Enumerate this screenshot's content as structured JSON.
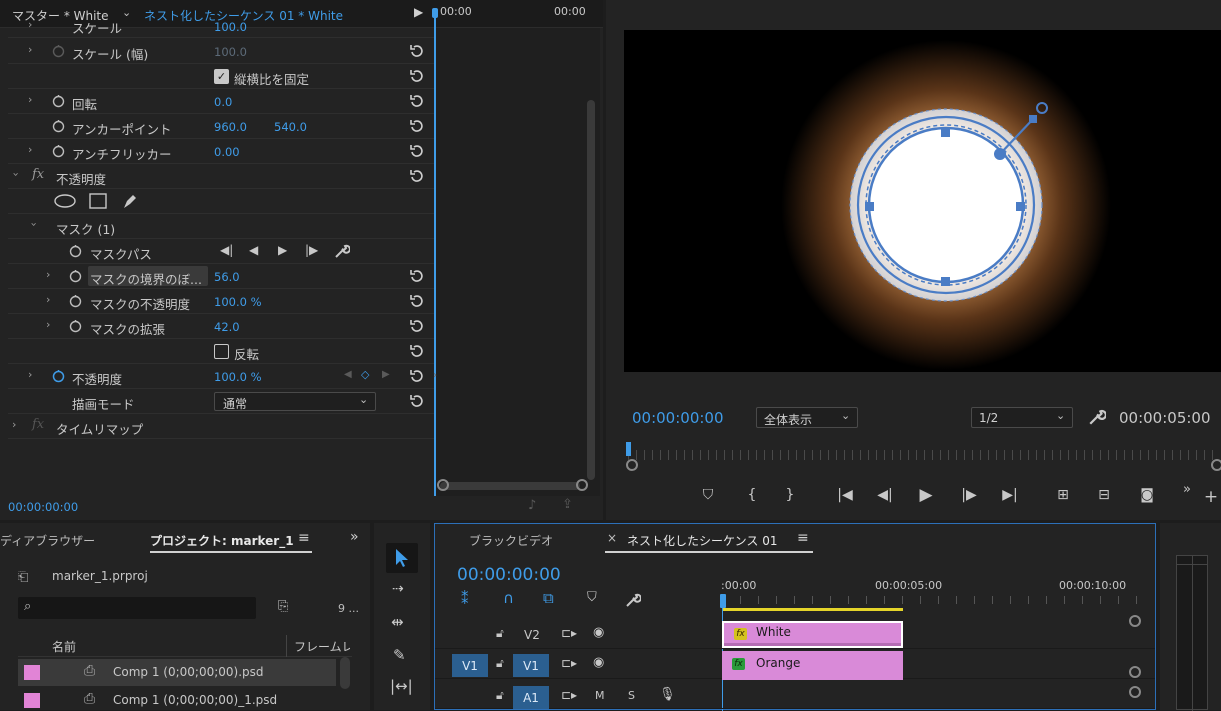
{
  "effect_controls": {
    "tab_master": "マスター * White",
    "tab_sequence": "ネスト化したシーケンス 01 * White",
    "tl_time_start": "00:00",
    "tl_time_end": "00:00",
    "footer_time": "00:00:00:00",
    "rows": {
      "scale": {
        "label": "スケール",
        "value": "100.0"
      },
      "scale_width": {
        "label": "スケール (幅)",
        "value": "100.0"
      },
      "uniform": {
        "label": "縦横比を固定"
      },
      "rotation": {
        "label": "回転",
        "value": "0.0"
      },
      "anchor": {
        "label": "アンカーポイント",
        "x": "960.0",
        "y": "540.0"
      },
      "antiflicker": {
        "label": "アンチフリッカー",
        "value": "0.00"
      },
      "opacity_group": {
        "label": "不透明度"
      },
      "mask": {
        "label": "マスク (1)"
      },
      "mask_path": {
        "label": "マスクパス"
      },
      "mask_feather": {
        "label": "マスクの境界のぼ...",
        "value": "56.0"
      },
      "mask_opacity": {
        "label": "マスクの不透明度",
        "value": "100.0 %"
      },
      "mask_expansion": {
        "label": "マスクの拡張",
        "value": "42.0"
      },
      "inverted": {
        "label": "反転"
      },
      "opacity": {
        "label": "不透明度",
        "value": "100.0 %"
      },
      "blend_mode": {
        "label": "描画モード",
        "value": "通常"
      },
      "time_remap": {
        "label": "タイムリマップ"
      }
    }
  },
  "program_monitor": {
    "timecode": "00:00:00:00",
    "fit": "全体表示",
    "resolution": "1/2",
    "duration": "00:00:05:00"
  },
  "project": {
    "tab_media": "ディアブラウザー",
    "tab_project": "プロジェクト: marker_1",
    "file_name": "marker_1.prproj",
    "item_count": "9 ...",
    "col_name": "名前",
    "col_framerate": "フレームレ",
    "items": [
      {
        "name": "Comp 1 (0;00;00;00).psd"
      },
      {
        "name": "Comp 1 (0;00;00;00)_1.psd"
      }
    ],
    "label_color": "#e184d6"
  },
  "timeline": {
    "tab_black": "ブラックビデオ",
    "tab_nested": "ネスト化したシーケンス 01",
    "timecode": "00:00:00:00",
    "ruler": [
      ":00:00",
      "00:00:05:00",
      "00:00:10:00"
    ],
    "tracks": {
      "v2": "V2",
      "v1_source": "V1",
      "v1": "V1",
      "a1": "A1",
      "mute": "M",
      "solo": "S"
    },
    "clips": [
      {
        "name": "White",
        "fx": "fx"
      },
      {
        "name": "Orange",
        "fx": "fx"
      }
    ],
    "clip_color": "#d98ad8"
  },
  "colors": {
    "accent": "#3f9ce8",
    "background": "#232323"
  }
}
